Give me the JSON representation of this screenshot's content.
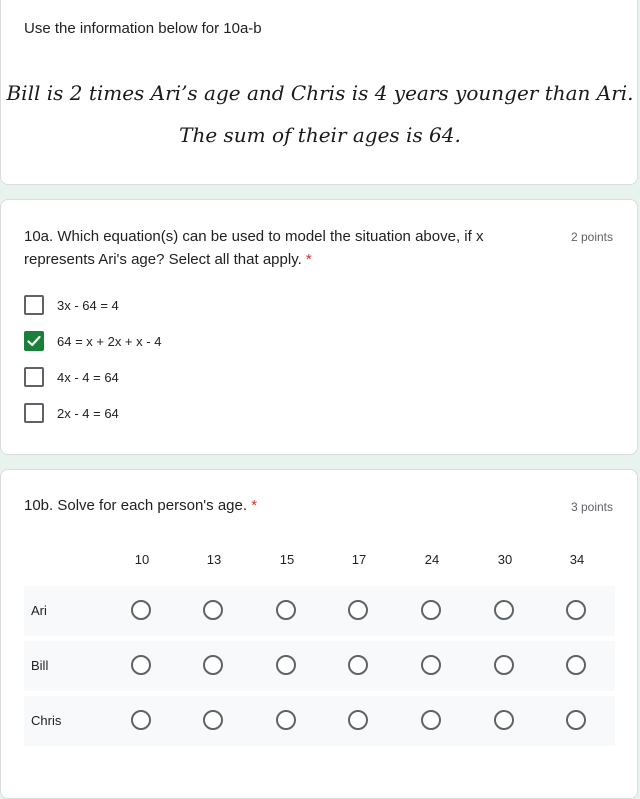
{
  "info": {
    "intro": "Use the information below for 10a-b",
    "problem_line1": "Bill is 2 times Ari’s age and Chris is 4 years younger than Ari.",
    "problem_line2": "The sum of their ages is 64."
  },
  "q10a": {
    "title_line1": "10a. Which equation(s) can be used to model the situation above, if x",
    "title_line2": "represents Ari's age? Select all that apply.",
    "required": "*",
    "points": "2 points",
    "options": [
      {
        "label": "3x - 64 = 4",
        "checked": false
      },
      {
        "label": "64 = x + 2x + x - 4",
        "checked": true
      },
      {
        "label": "4x - 4 = 64",
        "checked": false
      },
      {
        "label": "2x - 4 = 64",
        "checked": false
      }
    ]
  },
  "q10b": {
    "title": "10b. Solve for each person's age.",
    "required": "*",
    "points": "3 points",
    "columns": [
      "10",
      "13",
      "15",
      "17",
      "24",
      "30",
      "34"
    ],
    "rows": [
      "Ari",
      "Bill",
      "Chris"
    ]
  },
  "colors": {
    "accent_check": "#188038",
    "required": "#d93025",
    "background": "#e8f3ee"
  }
}
